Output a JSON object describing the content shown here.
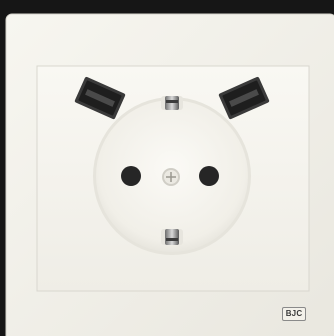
{
  "product": {
    "brand_label": "BJC"
  },
  "image": {
    "subject": "usb-schuko-wall-socket",
    "colors": {
      "background": "#161616",
      "frame": "#f2f0e9",
      "socket": "#f6f4ee",
      "usb_port": "#2a2a2a"
    }
  }
}
